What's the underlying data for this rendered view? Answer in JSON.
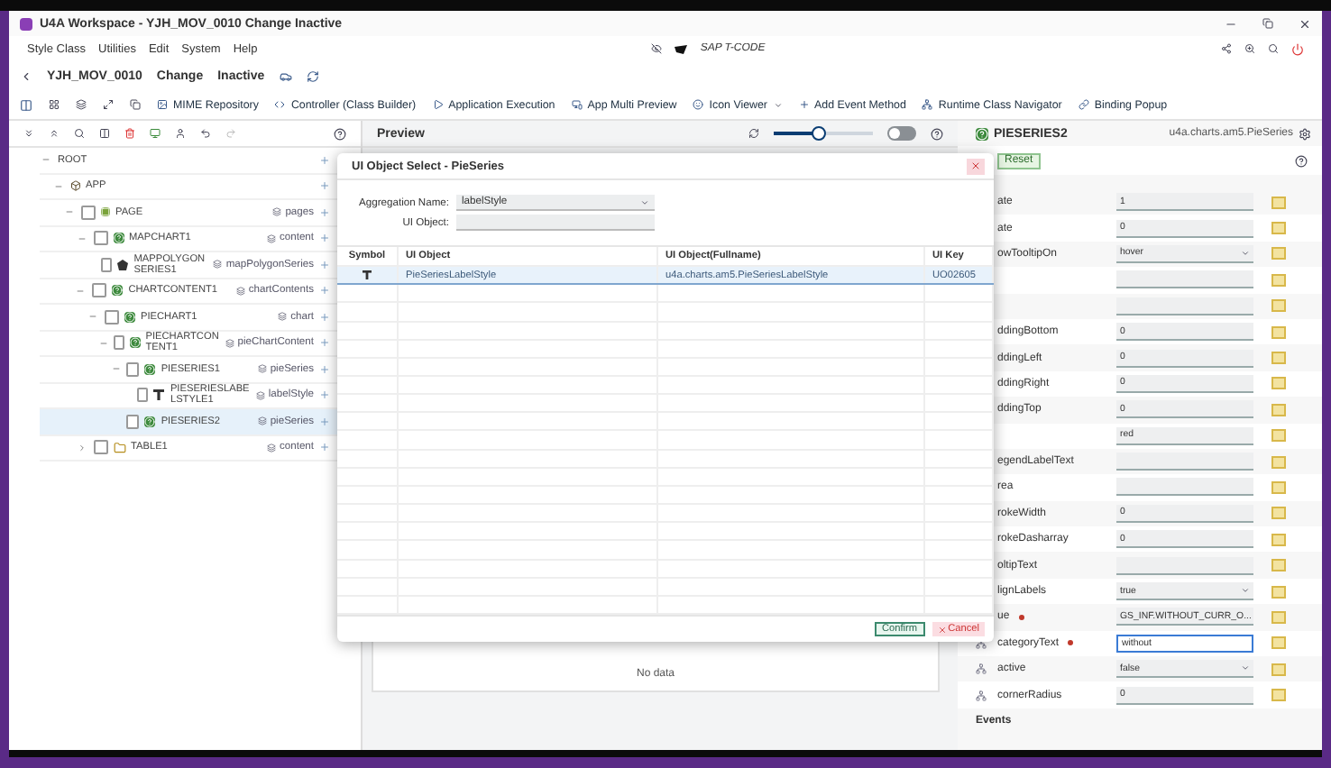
{
  "window": {
    "title": "U4A Workspace - YJH_MOV_0010 Change Inactive"
  },
  "menu": [
    "Style Class",
    "Utilities",
    "Edit",
    "System",
    "Help"
  ],
  "tcode": {
    "placeholder": "SAP T-CODE"
  },
  "header": {
    "app_id": "YJH_MOV_0010",
    "mode": "Change",
    "status": "Inactive"
  },
  "toolbar": [
    {
      "label": "MIME Repository",
      "kind": "mime"
    },
    {
      "label": "Controller (Class Builder)",
      "kind": "controller"
    },
    {
      "label": "Application Execution",
      "kind": "execute"
    },
    {
      "label": "App Multi Preview",
      "kind": "preview"
    },
    {
      "label": "Icon Viewer",
      "kind": "icons",
      "dropdown": true
    },
    {
      "label": "Add Event Method",
      "kind": "event"
    },
    {
      "label": "Runtime Class Navigator",
      "kind": "navigator"
    },
    {
      "label": "Binding Popup",
      "kind": "binding"
    }
  ],
  "tree": [
    {
      "name": "ROOT",
      "expanded": true,
      "selected": false,
      "children": [
        {
          "name": "APP",
          "kind": "app",
          "expanded": true,
          "selected": false,
          "children": [
            {
              "name": "PAGE",
              "kind": "page",
              "aggregation": "pages",
              "checked": false,
              "expanded": true,
              "selected": false,
              "children": [
                {
                  "name": "MAPCHART1",
                  "kind": "chart",
                  "aggregation": "content",
                  "checked": false,
                  "expanded": true,
                  "selected": false,
                  "children": [
                    {
                      "name": "MAPPOLYGONSERIES1",
                      "kind": "series",
                      "aggregation": "mapPolygonSeries",
                      "checked": false,
                      "selected": false
                    }
                  ]
                },
                {
                  "name": "CHARTCONTENT1",
                  "kind": "chart",
                  "aggregation": "chartContents",
                  "checked": false,
                  "expanded": true,
                  "selected": false,
                  "children": [
                    {
                      "name": "PIECHART1",
                      "kind": "chart",
                      "aggregation": "chart",
                      "checked": false,
                      "expanded": true,
                      "selected": false,
                      "children": [
                        {
                          "name": "PIECHARTCONTENT1",
                          "kind": "chart",
                          "aggregation": "pieChartContent",
                          "checked": false,
                          "expanded": true,
                          "selected": false,
                          "children": [
                            {
                              "name": "PIESERIES1",
                              "kind": "chart",
                              "aggregation": "pieSeries",
                              "checked": false,
                              "expanded": true,
                              "selected": false,
                              "children": [
                                {
                                  "name": "PIESERIESLABELSTYLE1",
                                  "kind": "style",
                                  "aggregation": "labelStyle",
                                  "checked": false,
                                  "selected": false
                                }
                              ]
                            },
                            {
                              "name": "PIESERIES2",
                              "kind": "chart",
                              "aggregation": "pieSeries",
                              "checked": false,
                              "selected": true
                            }
                          ]
                        }
                      ]
                    }
                  ]
                },
                {
                  "name": "TABLE1",
                  "kind": "table",
                  "aggregation": "content",
                  "checked": false,
                  "expanded": false,
                  "selected": false
                }
              ]
            }
          ]
        }
      ]
    }
  ],
  "preview": {
    "title": "Preview",
    "zoom": {
      "level": 0.45
    },
    "toggle": {
      "on": false
    },
    "empty_text": "No data"
  },
  "dialog": {
    "title": "UI Object Select - PieSeries",
    "fields": [
      {
        "label": "Aggregation Name:",
        "value": "labelStyle",
        "kind": "select"
      },
      {
        "label": "UI Object:",
        "kind": "input"
      }
    ],
    "columns": [
      "Symbol",
      "UI Object",
      "UI Object(Fullname)",
      "UI Key"
    ],
    "rows": [
      {
        "object": "PieSeriesLabelStyle",
        "fullname": "u4a.charts.am5.PieSeriesLabelStyle",
        "key": "UO02605",
        "selected": true
      }
    ],
    "confirm": "Confirm",
    "cancel": "Cancel"
  },
  "properties": {
    "object": "PIESERIES2",
    "class": "u4a.charts.am5.PieSeries",
    "reset": "Reset",
    "rows": [
      {
        "label": "ate",
        "value": "1",
        "kind": "input"
      },
      {
        "label": "ate",
        "value": "0",
        "kind": "input"
      },
      {
        "label": "owTooltipOn",
        "value": "hover",
        "kind": "select"
      },
      {
        "kind": "input"
      },
      {
        "kind": "input"
      },
      {
        "label": "ddingBottom",
        "value": "0",
        "kind": "input"
      },
      {
        "label": "ddingLeft",
        "value": "0",
        "kind": "input"
      },
      {
        "label": "ddingRight",
        "value": "0",
        "kind": "input"
      },
      {
        "label": "ddingTop",
        "value": "0",
        "kind": "input"
      },
      {
        "value": "red",
        "kind": "input"
      },
      {
        "label": "egendLabelText",
        "kind": "input"
      },
      {
        "label": "rea",
        "kind": "input"
      },
      {
        "label": "rokeWidth",
        "value": "0",
        "kind": "input"
      },
      {
        "label": "rokeDasharray",
        "value": "0",
        "kind": "input"
      },
      {
        "label": "oltipText",
        "kind": "input"
      },
      {
        "label": "lignLabels",
        "value": "true",
        "kind": "select"
      },
      {
        "label": "ue",
        "value": "GS_INF.WITHOUT_CURR_O...",
        "kind": "input",
        "required": true
      },
      {
        "label": "categoryText",
        "value": "without",
        "kind": "input",
        "required": true,
        "bound": true,
        "focused": true
      },
      {
        "label": "active",
        "value": "false",
        "kind": "select",
        "bound": true
      },
      {
        "label": "cornerRadius",
        "value": "0",
        "kind": "input",
        "bound": true
      }
    ],
    "events_title": "Events"
  }
}
